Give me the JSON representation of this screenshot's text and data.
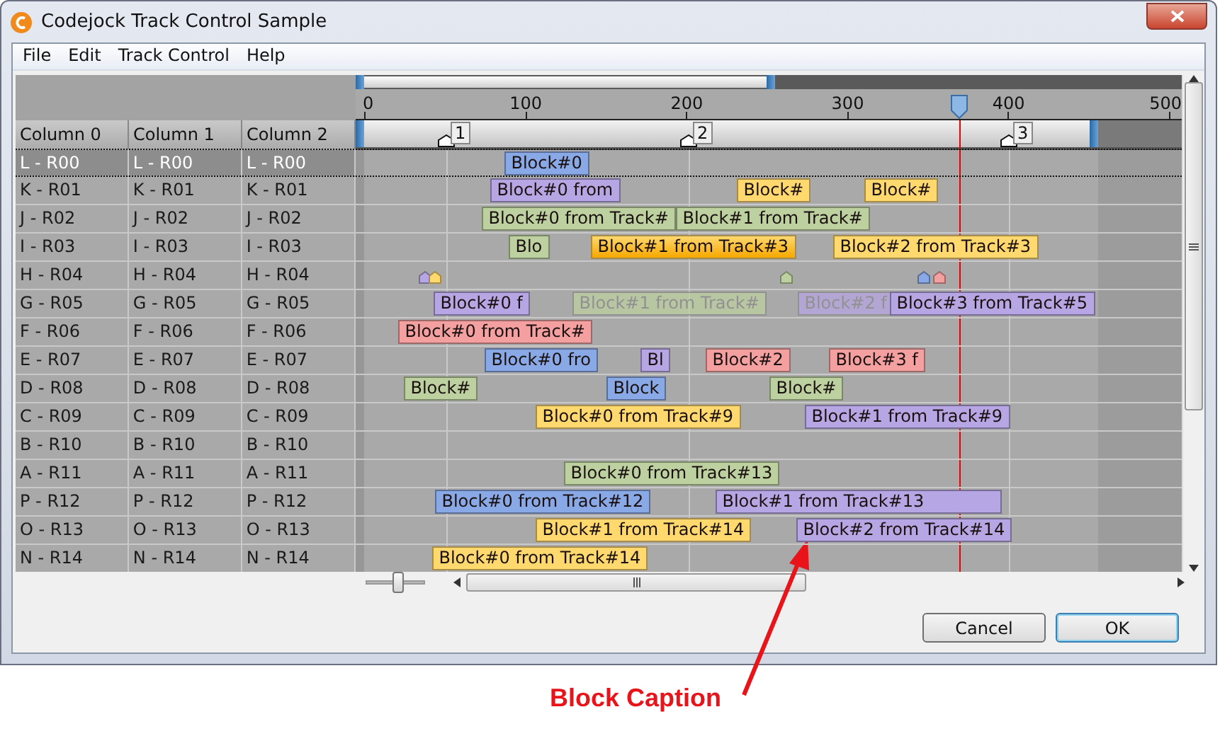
{
  "window": {
    "title": "Codejock Track Control Sample"
  },
  "menu": [
    "File",
    "Edit",
    "Track Control",
    "Help"
  ],
  "columns": [
    "Column 0",
    "Column 1",
    "Column 2"
  ],
  "ruler_labels": [
    "0",
    "100",
    "200",
    "300",
    "400",
    "500"
  ],
  "markers": [
    "1",
    "2",
    "3"
  ],
  "rows": [
    {
      "cells": [
        "L - R00",
        "L - R00",
        "L - R00"
      ],
      "selected": true,
      "blocks": [
        {
          "text": "Block#0",
          "color": "#89a8e6",
          "selected": false,
          "disabled": false
        }
      ]
    },
    {
      "cells": [
        "K - R01",
        "K - R01",
        "K - R01"
      ],
      "selected": false,
      "blocks": [
        {
          "text": "Block#0 from",
          "color": "#b7a6e4",
          "selected": false,
          "disabled": false
        },
        {
          "text": "Block#",
          "color": "#ffd86e",
          "selected": false,
          "disabled": false
        },
        {
          "text": "Block#",
          "color": "#ffd86e",
          "selected": false,
          "disabled": false
        }
      ]
    },
    {
      "cells": [
        "J - R02",
        "J - R02",
        "J - R02"
      ],
      "selected": false,
      "blocks": [
        {
          "text": "Block#0 from Track#",
          "color": "#bdd1a0",
          "selected": false,
          "disabled": false
        },
        {
          "text": "Block#1 from Track#",
          "color": "#bdd1a0",
          "selected": false,
          "disabled": false
        }
      ]
    },
    {
      "cells": [
        "I - R03",
        "I - R03",
        "I - R03"
      ],
      "selected": false,
      "blocks": [
        {
          "text": "Blo",
          "color": "#bdd1a0",
          "selected": false,
          "disabled": false
        },
        {
          "text": "Block#1 from Track#3",
          "color": "#ffd86e",
          "selected": true,
          "disabled": false
        },
        {
          "text": "Block#2 from Track#3",
          "color": "#ffd86e",
          "selected": false,
          "disabled": false
        }
      ]
    },
    {
      "cells": [
        "H - R04",
        "H - R04",
        "H - R04"
      ],
      "selected": false,
      "blocks": [],
      "marks": [
        {
          "color": "#b7a6e4"
        },
        {
          "color": "#ffd86e"
        },
        {
          "color": "#bdd1a0"
        },
        {
          "color": "#89a8e6"
        },
        {
          "color": "#f4a0a0"
        }
      ]
    },
    {
      "cells": [
        "G - R05",
        "G - R05",
        "G - R05"
      ],
      "selected": false,
      "blocks": [
        {
          "text": "Block#0 f",
          "color": "#b7a6e4",
          "selected": false,
          "disabled": false
        },
        {
          "text": "Block#1 from Track#",
          "color": "#bdd1a0",
          "selected": false,
          "disabled": true
        },
        {
          "text": "Block#2 f",
          "color": "#b7a6e4",
          "selected": false,
          "disabled": true
        },
        {
          "text": "Block#3 from Track#5",
          "color": "#b7a6e4",
          "selected": false,
          "disabled": false
        }
      ]
    },
    {
      "cells": [
        "F - R06",
        "F - R06",
        "F - R06"
      ],
      "selected": false,
      "blocks": [
        {
          "text": "Block#0 from Track#",
          "color": "#f4a0a0",
          "selected": false,
          "disabled": false
        }
      ]
    },
    {
      "cells": [
        "E - R07",
        "E - R07",
        "E - R07"
      ],
      "selected": false,
      "blocks": [
        {
          "text": "Block#0 fro",
          "color": "#89a8e6",
          "selected": false,
          "disabled": false
        },
        {
          "text": "Bl",
          "color": "#b7a6e4",
          "selected": false,
          "disabled": false
        },
        {
          "text": "Block#2",
          "color": "#f4a0a0",
          "selected": false,
          "disabled": false
        },
        {
          "text": "Block#3 f",
          "color": "#f4a0a0",
          "selected": false,
          "disabled": false
        }
      ]
    },
    {
      "cells": [
        "D - R08",
        "D - R08",
        "D - R08"
      ],
      "selected": false,
      "blocks": [
        {
          "text": "Block#",
          "color": "#bdd1a0",
          "selected": false,
          "disabled": false
        },
        {
          "text": "Block",
          "color": "#89a8e6",
          "selected": false,
          "disabled": false
        },
        {
          "text": "Block#",
          "color": "#bdd1a0",
          "selected": false,
          "disabled": false
        }
      ]
    },
    {
      "cells": [
        "C - R09",
        "C - R09",
        "C - R09"
      ],
      "selected": false,
      "blocks": [
        {
          "text": "Block#0 from Track#9",
          "color": "#ffd86e",
          "selected": false,
          "disabled": false
        },
        {
          "text": "Block#1 from Track#9",
          "color": "#b7a6e4",
          "selected": false,
          "disabled": false
        }
      ]
    },
    {
      "cells": [
        "B - R10",
        "B - R10",
        "B - R10"
      ],
      "selected": false,
      "blocks": []
    },
    {
      "cells": [
        "A - R11",
        "A - R11",
        "A - R11"
      ],
      "selected": false,
      "blocks": [
        {
          "text": "Block#0 from Track#13",
          "color": "#bdd1a0",
          "selected": false,
          "disabled": false
        }
      ]
    },
    {
      "cells": [
        "P - R12",
        "P - R12",
        "P - R12"
      ],
      "selected": false,
      "blocks": [
        {
          "text": "Block#0 from Track#12",
          "color": "#89a8e6",
          "selected": false,
          "disabled": false
        },
        {
          "text": "Block#1 from Track#13",
          "color": "#b7a6e4",
          "selected": false,
          "disabled": false
        }
      ]
    },
    {
      "cells": [
        "O - R13",
        "O - R13",
        "O - R13"
      ],
      "selected": false,
      "blocks": [
        {
          "text": "Block#1 from Track#14",
          "color": "#ffd86e",
          "selected": false,
          "disabled": false
        },
        {
          "text": "Block#2 from Track#14",
          "color": "#b7a6e4",
          "selected": false,
          "disabled": false
        }
      ]
    },
    {
      "cells": [
        "N - R14",
        "N - R14",
        "N - R14"
      ],
      "selected": false,
      "blocks": [
        {
          "text": "Block#0 from Track#14",
          "color": "#ffd86e",
          "selected": false,
          "disabled": false
        }
      ]
    }
  ],
  "zoom": {
    "level": 0.55
  },
  "buttons": [
    {
      "label": "Cancel",
      "default": false
    },
    {
      "label": "OK",
      "default": true
    }
  ],
  "annotation": {
    "text": "Block Caption"
  }
}
